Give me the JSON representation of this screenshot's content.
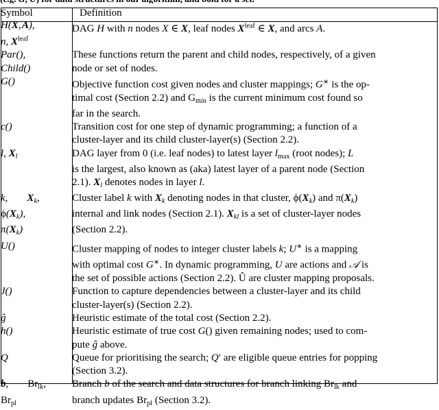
{
  "caption": {
    "clipped_line": "(e.g. G, U) for data structures in our algorithm, and bold for a set."
  },
  "table": {
    "columns": [
      "Symbol",
      "Definition"
    ],
    "rows": [
      {
        "symbol_lines": [
          "H(X, A),",
          "n, X^leaf"
        ],
        "symbol_plain": "H(X, A), n, X^leaf",
        "definition": "DAG H with n nodes X ∈ X, leaf nodes X^leaf ∈ X, and arcs A."
      },
      {
        "symbol_lines": [
          "Par(),",
          "Child()"
        ],
        "symbol_plain": "Par(), Child()",
        "definition": "These functions return the parent and child nodes, respectively, of a given node or set of nodes."
      },
      {
        "symbol_lines": [
          "G()"
        ],
        "symbol_plain": "G()",
        "definition": "Objective function cost given nodes and cluster mappings; G* is the optimal cost (Section 2.2) and G_min is the current minimum cost found so far in the search."
      },
      {
        "symbol_lines": [
          "c()"
        ],
        "symbol_plain": "c()",
        "definition": "Transition cost for one step of dynamic programming; a function of a cluster-layer and its child cluster-layer(s) (Section 2.2)."
      },
      {
        "symbol_lines": [
          "l, X_l"
        ],
        "symbol_plain": "l, X_l",
        "definition": "DAG layer from 0 (i.e. leaf nodes) to latest layer l_max (root nodes); L is the largest, also known as (aka) latest layer of a parent node (Section 2.1). X_l denotes nodes in layer l."
      },
      {
        "symbol_lines": [
          "k,     X_k,",
          "φ(X_k),",
          "π(X_k)"
        ],
        "symbol_plain": "k, X_k, φ(X_k), π(X_k)",
        "definition": "Cluster label k with X_k denoting nodes in that cluster, φ(X_k) and π(X_k) internal and link nodes (Section 2.1). X_kl is a set of cluster-layer nodes (Section 2.2)."
      },
      {
        "symbol_lines": [
          "U()"
        ],
        "symbol_plain": "U()",
        "definition": "Cluster mapping of nodes to integer cluster labels k; U* is a mapping with optimal cost G*. In dynamic programming, U are actions and A is the set of possible actions (Section 2.2). Û are cluster mapping proposals."
      },
      {
        "symbol_lines": [
          "J()"
        ],
        "symbol_plain": "J()",
        "definition": "Function to capture dependencies between a cluster-layer and its child cluster-layer(s) (Section 2.2)."
      },
      {
        "symbol_lines": [
          "ĝ"
        ],
        "symbol_plain": "ĝ",
        "definition": "Heuristic estimate of the total cost (Section 2.2)."
      },
      {
        "symbol_lines": [
          "h()"
        ],
        "symbol_plain": "h()",
        "definition": "Heuristic estimate of true cost G() given remaining nodes; used to compute ĝ above."
      },
      {
        "symbol_lines": [
          "Q"
        ],
        "symbol_plain": "Q",
        "definition": "Queue for prioritising the search; Q′ are eligible queue entries for popping (Section 3.2)."
      },
      {
        "symbol_lines": [
          "b,     Br_lk,",
          "Br_pl"
        ],
        "symbol_plain": "b, Br_lk, Br_pl",
        "definition": "Branch b of the search and data structures for branch linking Br_lk and branch updates Br_pl (Section 3.2)."
      }
    ]
  },
  "colors": {
    "page_background": "#ffffff",
    "text": "#000000",
    "rule": "#000000"
  }
}
